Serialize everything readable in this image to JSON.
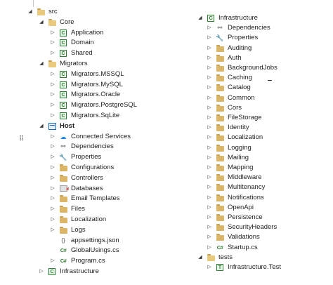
{
  "left_tree": [
    {
      "label": "src",
      "expanded": true,
      "icon": "folder-open-icon",
      "depth": 0
    },
    {
      "label": "Core",
      "expanded": true,
      "icon": "folder-open-icon",
      "depth": 1
    },
    {
      "label": "Application",
      "expanded": false,
      "icon": "csharp-project-icon",
      "depth": 2
    },
    {
      "label": "Domain",
      "expanded": false,
      "icon": "csharp-project-icon",
      "depth": 2
    },
    {
      "label": "Shared",
      "expanded": false,
      "icon": "csharp-project-icon",
      "depth": 2
    },
    {
      "label": "Migrators",
      "expanded": true,
      "icon": "folder-open-icon",
      "depth": 1
    },
    {
      "label": "Migrators.MSSQL",
      "expanded": false,
      "icon": "csharp-project-icon",
      "depth": 2
    },
    {
      "label": "Migrators.MySQL",
      "expanded": false,
      "icon": "csharp-project-icon",
      "depth": 2
    },
    {
      "label": "Migrators.Oracle",
      "expanded": false,
      "icon": "csharp-project-icon",
      "depth": 2
    },
    {
      "label": "Migrators.PostgreSQL",
      "expanded": false,
      "icon": "csharp-project-icon",
      "depth": 2
    },
    {
      "label": "Migrators.SqLite",
      "expanded": false,
      "icon": "csharp-project-icon",
      "depth": 2
    },
    {
      "label": "Host",
      "expanded": true,
      "icon": "web-project-icon",
      "depth": 1,
      "bold": true
    },
    {
      "label": "Connected Services",
      "expanded": false,
      "icon": "connected-services-icon",
      "depth": 2
    },
    {
      "label": "Dependencies",
      "expanded": false,
      "icon": "dependencies-icon",
      "depth": 2
    },
    {
      "label": "Properties",
      "expanded": false,
      "icon": "properties-icon",
      "depth": 2
    },
    {
      "label": "Configurations",
      "expanded": false,
      "icon": "folder-icon",
      "depth": 2
    },
    {
      "label": "Controllers",
      "expanded": false,
      "icon": "folder-icon",
      "depth": 2
    },
    {
      "label": "Databases",
      "expanded": false,
      "icon": "database-excluded-icon",
      "depth": 2
    },
    {
      "label": "Email Templates",
      "expanded": false,
      "icon": "folder-icon",
      "depth": 2
    },
    {
      "label": "Files",
      "expanded": false,
      "icon": "folder-icon",
      "depth": 2
    },
    {
      "label": "Localization",
      "expanded": false,
      "icon": "folder-icon",
      "depth": 2
    },
    {
      "label": "Logs",
      "expanded": false,
      "icon": "folder-icon",
      "depth": 2
    },
    {
      "label": "appsettings.json",
      "expanded": null,
      "icon": "json-file-icon",
      "depth": 2
    },
    {
      "label": "GlobalUsings.cs",
      "expanded": null,
      "icon": "csharp-file-icon",
      "depth": 2
    },
    {
      "label": "Program.cs",
      "expanded": false,
      "icon": "csharp-file-icon",
      "depth": 2
    },
    {
      "label": "Infrastructure",
      "expanded": false,
      "icon": "csharp-project-icon",
      "depth": 1
    }
  ],
  "right_tree": [
    {
      "label": "Infrastructure",
      "expanded": true,
      "icon": "csharp-project-icon",
      "depth": 0
    },
    {
      "label": "Dependencies",
      "expanded": false,
      "icon": "dependencies-icon",
      "depth": 1
    },
    {
      "label": "Properties",
      "expanded": false,
      "icon": "properties-icon",
      "depth": 1
    },
    {
      "label": "Auditing",
      "expanded": false,
      "icon": "folder-icon",
      "depth": 1
    },
    {
      "label": "Auth",
      "expanded": false,
      "icon": "folder-icon",
      "depth": 1
    },
    {
      "label": "BackgroundJobs",
      "expanded": false,
      "icon": "folder-icon",
      "depth": 1
    },
    {
      "label": "Caching",
      "expanded": false,
      "icon": "folder-icon",
      "depth": 1
    },
    {
      "label": "Catalog",
      "expanded": false,
      "icon": "folder-icon",
      "depth": 1
    },
    {
      "label": "Common",
      "expanded": false,
      "icon": "folder-icon",
      "depth": 1
    },
    {
      "label": "Cors",
      "expanded": false,
      "icon": "folder-icon",
      "depth": 1
    },
    {
      "label": "FileStorage",
      "expanded": false,
      "icon": "folder-icon",
      "depth": 1
    },
    {
      "label": "Identity",
      "expanded": false,
      "icon": "folder-icon",
      "depth": 1
    },
    {
      "label": "Localization",
      "expanded": false,
      "icon": "folder-icon",
      "depth": 1
    },
    {
      "label": "Logging",
      "expanded": false,
      "icon": "folder-icon",
      "depth": 1
    },
    {
      "label": "Mailing",
      "expanded": false,
      "icon": "folder-icon",
      "depth": 1
    },
    {
      "label": "Mapping",
      "expanded": false,
      "icon": "folder-icon",
      "depth": 1
    },
    {
      "label": "Middleware",
      "expanded": false,
      "icon": "folder-icon",
      "depth": 1
    },
    {
      "label": "Multitenancy",
      "expanded": false,
      "icon": "folder-icon",
      "depth": 1
    },
    {
      "label": "Notifications",
      "expanded": false,
      "icon": "folder-icon",
      "depth": 1
    },
    {
      "label": "OpenApi",
      "expanded": false,
      "icon": "folder-icon",
      "depth": 1
    },
    {
      "label": "Persistence",
      "expanded": false,
      "icon": "folder-icon",
      "depth": 1
    },
    {
      "label": "SecurityHeaders",
      "expanded": false,
      "icon": "folder-icon",
      "depth": 1
    },
    {
      "label": "Validations",
      "expanded": false,
      "icon": "folder-icon",
      "depth": 1
    },
    {
      "label": "Startup.cs",
      "expanded": false,
      "icon": "csharp-file-icon",
      "depth": 1
    },
    {
      "label": "tests",
      "expanded": true,
      "icon": "folder-open-icon",
      "depth": 0
    },
    {
      "label": "Infrastructure.Test",
      "expanded": false,
      "icon": "test-project-icon",
      "depth": 1
    }
  ],
  "colors": {
    "folder": "#dcb668",
    "project": "#2e7d32",
    "web_project": "#1565c0",
    "background": "#ffffff"
  }
}
